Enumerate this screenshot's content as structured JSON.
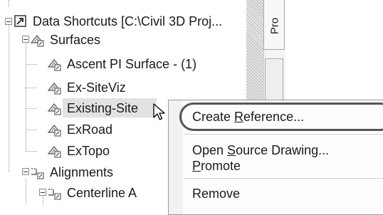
{
  "tree": {
    "root": {
      "label": "Data Shortcuts [C:\\Civil 3D Proj...",
      "icon": "data-shortcuts-icon"
    },
    "surfaces": {
      "label": "Surfaces",
      "icon": "surfaces-folder-icon"
    },
    "surface_items": [
      {
        "label": "Ascent PI Surface - (1)",
        "icon": "surface-shortcut-icon"
      },
      {
        "label": "Ex-SiteViz",
        "icon": "surface-shortcut-icon"
      },
      {
        "label": "Existing-Site",
        "icon": "surface-shortcut-icon"
      },
      {
        "label": "ExRoad",
        "icon": "surface-shortcut-icon"
      },
      {
        "label": "ExTopo",
        "icon": "surface-shortcut-icon"
      }
    ],
    "alignments": {
      "label": "Alignments",
      "icon": "alignments-folder-icon"
    },
    "alignment_items": [
      {
        "label": "Centerline A",
        "icon": "alignment-shortcut-icon"
      }
    ]
  },
  "side_tab": {
    "label": "Pro"
  },
  "context_menu": {
    "items": [
      {
        "before": "Create ",
        "mnemonic": "R",
        "after": "eference..."
      },
      {
        "before": "Open ",
        "mnemonic": "S",
        "after": "ource Drawing..."
      },
      {
        "before": "",
        "mnemonic": "P",
        "after": "romote"
      },
      {
        "before": "Remove",
        "mnemonic": "",
        "after": ""
      }
    ]
  },
  "colors": {
    "highlight": "#e2e2e2",
    "menu_border": "#9a9a9a",
    "focus_ring": "#555555"
  }
}
